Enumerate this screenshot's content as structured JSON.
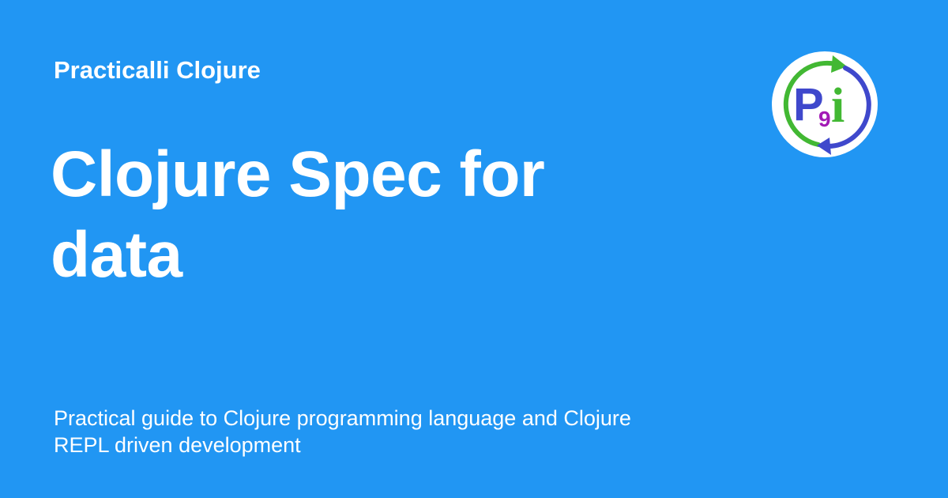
{
  "site_name": "Practicalli Clojure",
  "page_title": "Clojure Spec for data",
  "page_description": "Practical guide to Clojure programming language and Clojure REPL driven development",
  "logo": {
    "icon": "practicalli-logo-icon",
    "letters": {
      "p": "P",
      "nine": "9",
      "i": "i"
    }
  },
  "colors": {
    "background": "#2196f3",
    "text": "#ffffff",
    "logo_green": "#42b833",
    "logo_blue": "#3f48cc",
    "logo_purple": "#a21ab5"
  }
}
